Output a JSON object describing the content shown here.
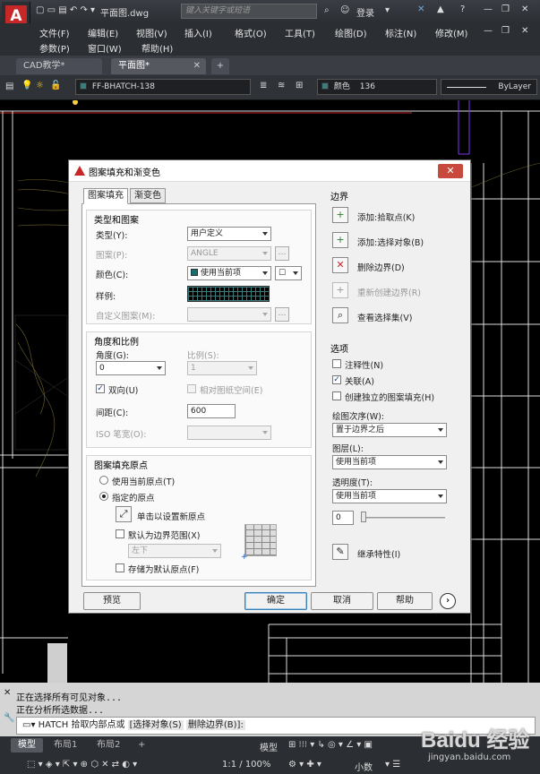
{
  "titlebar": {
    "logo_letter": "A",
    "filename": "平面图.dwg",
    "search_placeholder": "键入关键字或短语",
    "login": "登录",
    "help": "?"
  },
  "menu": {
    "row1": [
      "文件(F)",
      "编辑(E)",
      "视图(V)",
      "插入(I)",
      "格式(O)",
      "工具(T)",
      "绘图(D)",
      "标注(N)",
      "修改(M)"
    ],
    "row2": [
      "参数(P)",
      "窗口(W)",
      "帮助(H)"
    ]
  },
  "doc_tabs": [
    "CAD教学*",
    "平面图*"
  ],
  "doc_tab_add": "+",
  "layerbar": {
    "layer_name": "FF-BHATCH-138",
    "color_label": "颜色",
    "color_value": "136",
    "linetype": "ByLayer"
  },
  "dialog": {
    "title": "图案填充和渐变色",
    "tabs": [
      "图案填充",
      "渐变色"
    ],
    "type_group": {
      "title": "类型和图案",
      "type_label": "类型(Y):",
      "type_value": "用户定义",
      "pattern_label": "图案(P):",
      "pattern_value": "ANGLE",
      "color_label": "颜色(C):",
      "color_value": "使用当前项",
      "color2_value": "☐",
      "sample_label": "样例:",
      "custom_label": "自定义图案(M):"
    },
    "angle_group": {
      "title": "角度和比例",
      "angle_label": "角度(G):",
      "angle_value": "0",
      "scale_label": "比例(S):",
      "scale_value": "1",
      "double_label": "双向(U)",
      "relative_label": "相对图纸空间(E)",
      "spacing_label": "间距(C):",
      "spacing_value": "600",
      "iso_label": "ISO 笔宽(O):"
    },
    "origin_group": {
      "title": "图案填充原点",
      "current_label": "使用当前原点(T)",
      "specified_label": "指定的原点",
      "click_label": "单击以设置新原点",
      "default_label": "默认为边界范围(X)",
      "position_value": "左下",
      "store_label": "存储为默认原点(F)"
    },
    "boundary": {
      "title": "边界",
      "add_pick": "添加:拾取点(K)",
      "add_select": "添加:选择对象(B)",
      "remove": "删除边界(D)",
      "recreate": "重新创建边界(R)",
      "view": "查看选择集(V)"
    },
    "options": {
      "title": "选项",
      "annotative": "注释性(N)",
      "associative": "关联(A)",
      "separate": "创建独立的图案填充(H)",
      "draw_order_label": "绘图次序(W):",
      "draw_order_value": "置于边界之后",
      "layer_label": "图层(L):",
      "layer_value": "使用当前项",
      "transparency_label": "透明度(T):",
      "transparency_value": "使用当前项",
      "transparency_number": "0"
    },
    "inherit": "继承特性(I)",
    "buttons": {
      "preview": "预览",
      "ok": "确定",
      "cancel": "取消",
      "help": "帮助"
    }
  },
  "command": {
    "line1": "正在选择所有可见对象...",
    "line2": "正在分析所选数据...",
    "prompt_prefix": "HATCH 拾取内部点或",
    "opt1": "[选择对象(S)",
    "opt2": "删除边界(B)]:"
  },
  "layout_tabs": [
    "模型",
    "布局1",
    "布局2"
  ],
  "layout_add": "+",
  "status": {
    "model": "模型",
    "scale": "1:1 / 100%",
    "units": "小数"
  },
  "watermark": "Baidu 经验",
  "watermark_url": "jingyan.baidu.com",
  "colors": {
    "accent_red": "#c62828",
    "dialog_bg": "#f0f0f0",
    "hatch_teal": "#3b7d7d"
  }
}
